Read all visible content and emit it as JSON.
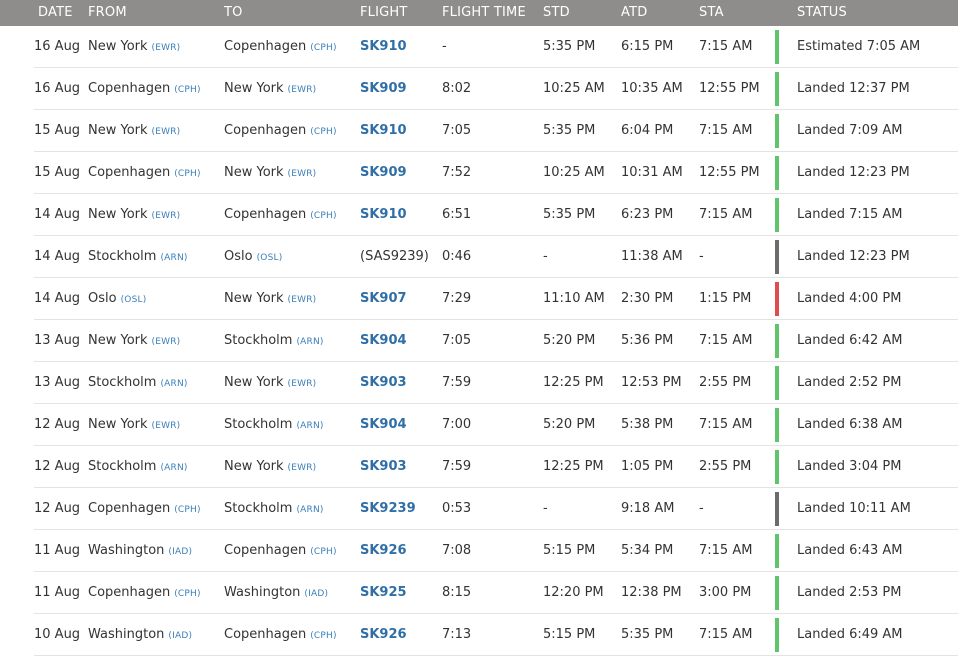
{
  "header": {
    "date": "DATE",
    "from": "FROM",
    "to": "TO",
    "flight": "FLIGHT",
    "flight_time": "FLIGHT TIME",
    "std": "STD",
    "atd": "ATD",
    "sta": "STA",
    "status": "STATUS"
  },
  "colors": {
    "on_time": "#5fc46a",
    "delayed": "#e04b4b",
    "unknown": "#6b6b6b",
    "link": "#2f6fa6",
    "header_bg": "#8f8c8c"
  },
  "rows": [
    {
      "date": "16 Aug",
      "from_city": "New York",
      "from_code": "(EWR)",
      "to_city": "Copenhagen",
      "to_code": "(CPH)",
      "flight": "SK910",
      "flight_link": true,
      "flight_time": "-",
      "std": "5:35 PM",
      "atd": "6:15 PM",
      "sta": "7:15 AM",
      "status_color": "#5fc46a",
      "status": "Estimated 7:05 AM"
    },
    {
      "date": "16 Aug",
      "from_city": "Copenhagen",
      "from_code": "(CPH)",
      "to_city": "New York",
      "to_code": "(EWR)",
      "flight": "SK909",
      "flight_link": true,
      "flight_time": "8:02",
      "std": "10:25 AM",
      "atd": "10:35 AM",
      "sta": "12:55 PM",
      "status_color": "#5fc46a",
      "status": "Landed 12:37 PM"
    },
    {
      "date": "15 Aug",
      "from_city": "New York",
      "from_code": "(EWR)",
      "to_city": "Copenhagen",
      "to_code": "(CPH)",
      "flight": "SK910",
      "flight_link": true,
      "flight_time": "7:05",
      "std": "5:35 PM",
      "atd": "6:04 PM",
      "sta": "7:15 AM",
      "status_color": "#5fc46a",
      "status": "Landed 7:09 AM"
    },
    {
      "date": "15 Aug",
      "from_city": "Copenhagen",
      "from_code": "(CPH)",
      "to_city": "New York",
      "to_code": "(EWR)",
      "flight": "SK909",
      "flight_link": true,
      "flight_time": "7:52",
      "std": "10:25 AM",
      "atd": "10:31 AM",
      "sta": "12:55 PM",
      "status_color": "#5fc46a",
      "status": "Landed 12:23 PM"
    },
    {
      "date": "14 Aug",
      "from_city": "New York",
      "from_code": "(EWR)",
      "to_city": "Copenhagen",
      "to_code": "(CPH)",
      "flight": "SK910",
      "flight_link": true,
      "flight_time": "6:51",
      "std": "5:35 PM",
      "atd": "6:23 PM",
      "sta": "7:15 AM",
      "status_color": "#5fc46a",
      "status": "Landed 7:15 AM"
    },
    {
      "date": "14 Aug",
      "from_city": "Stockholm",
      "from_code": "(ARN)",
      "to_city": "Oslo",
      "to_code": "(OSL)",
      "flight": "(SAS9239)",
      "flight_link": false,
      "flight_time": "0:46",
      "std": "-",
      "atd": "11:38 AM",
      "sta": "-",
      "status_color": "#6b6b6b",
      "status": "Landed 12:23 PM"
    },
    {
      "date": "14 Aug",
      "from_city": "Oslo",
      "from_code": "(OSL)",
      "to_city": "New York",
      "to_code": "(EWR)",
      "flight": "SK907",
      "flight_link": true,
      "flight_time": "7:29",
      "std": "11:10 AM",
      "atd": "2:30 PM",
      "sta": "1:15 PM",
      "status_color": "#e04b4b",
      "status": "Landed 4:00 PM"
    },
    {
      "date": "13 Aug",
      "from_city": "New York",
      "from_code": "(EWR)",
      "to_city": "Stockholm",
      "to_code": "(ARN)",
      "flight": "SK904",
      "flight_link": true,
      "flight_time": "7:05",
      "std": "5:20 PM",
      "atd": "5:36 PM",
      "sta": "7:15 AM",
      "status_color": "#5fc46a",
      "status": "Landed 6:42 AM"
    },
    {
      "date": "13 Aug",
      "from_city": "Stockholm",
      "from_code": "(ARN)",
      "to_city": "New York",
      "to_code": "(EWR)",
      "flight": "SK903",
      "flight_link": true,
      "flight_time": "7:59",
      "std": "12:25 PM",
      "atd": "12:53 PM",
      "sta": "2:55 PM",
      "status_color": "#5fc46a",
      "status": "Landed 2:52 PM"
    },
    {
      "date": "12 Aug",
      "from_city": "New York",
      "from_code": "(EWR)",
      "to_city": "Stockholm",
      "to_code": "(ARN)",
      "flight": "SK904",
      "flight_link": true,
      "flight_time": "7:00",
      "std": "5:20 PM",
      "atd": "5:38 PM",
      "sta": "7:15 AM",
      "status_color": "#5fc46a",
      "status": "Landed 6:38 AM"
    },
    {
      "date": "12 Aug",
      "from_city": "Stockholm",
      "from_code": "(ARN)",
      "to_city": "New York",
      "to_code": "(EWR)",
      "flight": "SK903",
      "flight_link": true,
      "flight_time": "7:59",
      "std": "12:25 PM",
      "atd": "1:05 PM",
      "sta": "2:55 PM",
      "status_color": "#5fc46a",
      "status": "Landed 3:04 PM"
    },
    {
      "date": "12 Aug",
      "from_city": "Copenhagen",
      "from_code": "(CPH)",
      "to_city": "Stockholm",
      "to_code": "(ARN)",
      "flight": "SK9239",
      "flight_link": true,
      "flight_time": "0:53",
      "std": "-",
      "atd": "9:18 AM",
      "sta": "-",
      "status_color": "#6b6b6b",
      "status": "Landed 10:11 AM"
    },
    {
      "date": "11 Aug",
      "from_city": "Washington",
      "from_code": "(IAD)",
      "to_city": "Copenhagen",
      "to_code": "(CPH)",
      "flight": "SK926",
      "flight_link": true,
      "flight_time": "7:08",
      "std": "5:15 PM",
      "atd": "5:34 PM",
      "sta": "7:15 AM",
      "status_color": "#5fc46a",
      "status": "Landed 6:43 AM"
    },
    {
      "date": "11 Aug",
      "from_city": "Copenhagen",
      "from_code": "(CPH)",
      "to_city": "Washington",
      "to_code": "(IAD)",
      "flight": "SK925",
      "flight_link": true,
      "flight_time": "8:15",
      "std": "12:20 PM",
      "atd": "12:38 PM",
      "sta": "3:00 PM",
      "status_color": "#5fc46a",
      "status": "Landed 2:53 PM"
    },
    {
      "date": "10 Aug",
      "from_city": "Washington",
      "from_code": "(IAD)",
      "to_city": "Copenhagen",
      "to_code": "(CPH)",
      "flight": "SK926",
      "flight_link": true,
      "flight_time": "7:13",
      "std": "5:15 PM",
      "atd": "5:35 PM",
      "sta": "7:15 AM",
      "status_color": "#5fc46a",
      "status": "Landed 6:49 AM"
    }
  ]
}
